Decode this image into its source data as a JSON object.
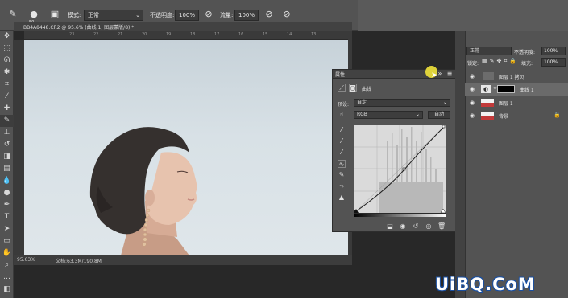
{
  "optbar": {
    "brush_size": "50",
    "mode_label": "模式:",
    "mode_value": "正常",
    "opacity_label": "不透明度:",
    "opacity_value": "100%",
    "flow_label": "流量:",
    "flow_value": "100%"
  },
  "doc": {
    "tab_title": "BB4A8448.CR2 @ 95.6% (曲线 1, 图层蒙版/8) *",
    "ruler_marks": [
      "23",
      "22",
      "21",
      "20",
      "19",
      "18",
      "17",
      "16",
      "15",
      "14",
      "13"
    ],
    "status_zoom": "95.63%",
    "status_doc": "文档:63.3M/190.8M"
  },
  "properties": {
    "panel_title": "属性",
    "type_label": "曲线",
    "preset_label": "预设:",
    "preset_value": "自定",
    "channel_value": "RGB",
    "auto_button": "自动"
  },
  "layers": {
    "blend_mode": "正常",
    "opacity_label": "不透明度:",
    "opacity_value": "100%",
    "lock_label": "锁定:",
    "fill_label": "填充:",
    "fill_value": "100%",
    "items": [
      {
        "name": "图层 1 拷贝"
      },
      {
        "name": "曲线 1"
      },
      {
        "name": "图层 1"
      },
      {
        "name": "背景"
      }
    ]
  },
  "watermark": "UiBQ.CoM",
  "colors": {
    "accent_cursor": "#f1e33b",
    "watermark_outline": "#1a4fa0"
  }
}
